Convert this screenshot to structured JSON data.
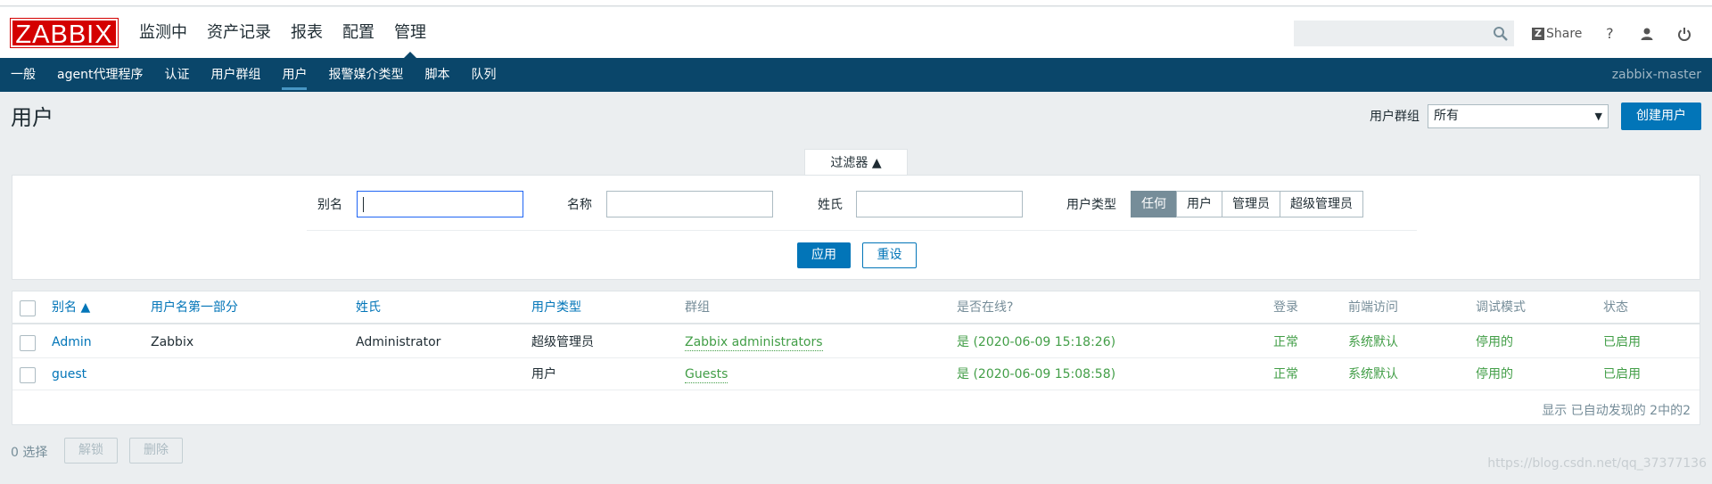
{
  "header": {
    "logo": "ZABBIX",
    "nav": [
      "监测中",
      "资产记录",
      "报表",
      "配置",
      "管理"
    ],
    "active_nav": 4,
    "share_label": "Share",
    "help_label": "?"
  },
  "subnav": {
    "items": [
      "一般",
      "agent代理程序",
      "认证",
      "用户群组",
      "用户",
      "报警媒介类型",
      "脚本",
      "队列"
    ],
    "active": 4,
    "server": "zabbix-master"
  },
  "page": {
    "title": "用户",
    "group_label": "用户群组",
    "group_value": "所有",
    "create_button": "创建用户"
  },
  "filter": {
    "tab_label": "过滤器 ▲",
    "alias_label": "别名",
    "alias_value": "",
    "name_label": "名称",
    "name_value": "",
    "surname_label": "姓氏",
    "surname_value": "",
    "type_label": "用户类型",
    "type_options": [
      "任何",
      "用户",
      "管理员",
      "超级管理员"
    ],
    "type_selected": "任何",
    "apply": "应用",
    "reset": "重设"
  },
  "table": {
    "columns": [
      "别名 ▲",
      "用户名第一部分",
      "姓氏",
      "用户类型",
      "群组",
      "是否在线?",
      "登录",
      "前端访问",
      "调试模式",
      "状态"
    ],
    "rows": [
      {
        "alias": "Admin",
        "name": "Zabbix",
        "surname": "Administrator",
        "type": "超级管理员",
        "groups": "Zabbix administrators",
        "online": "是 (2020-06-09 15:18:26)",
        "login": "正常",
        "frontend": "系统默认",
        "debug": "停用的",
        "status": "已启用"
      },
      {
        "alias": "guest",
        "name": "",
        "surname": "",
        "type": "用户",
        "groups": "Guests",
        "online": "是 (2020-06-09 15:08:58)",
        "login": "正常",
        "frontend": "系统默认",
        "debug": "停用的",
        "status": "已启用"
      }
    ],
    "footer": "显示 已自动发现的 2中的2"
  },
  "actions": {
    "selected": "0 选择",
    "unlock": "解锁",
    "delete": "删除"
  },
  "watermark": "https://blog.csdn.net/qq_37377136",
  "colors": {
    "brand": "#d40000",
    "nav_bg": "#0a466a",
    "accent": "#0275b8",
    "ok": "#429e47"
  }
}
